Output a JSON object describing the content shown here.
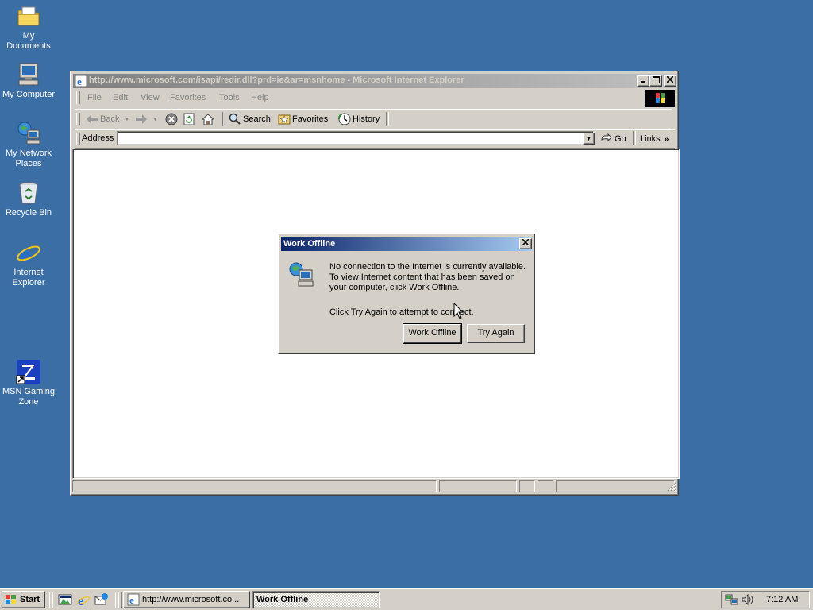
{
  "desktop": {
    "icons": [
      {
        "label": "My Documents",
        "icon": "folder-documents-icon"
      },
      {
        "label": "My Computer",
        "icon": "computer-icon"
      },
      {
        "label": "My Network Places",
        "icon": "network-places-icon"
      },
      {
        "label": "Recycle Bin",
        "icon": "recycle-bin-icon"
      },
      {
        "label": "Internet Explorer",
        "icon": "internet-explorer-icon"
      },
      {
        "label": "MSN Gaming Zone",
        "icon": "msn-gaming-zone-icon"
      }
    ]
  },
  "browser": {
    "title": "http://www.microsoft.com/isapi/redir.dll?prd=ie&ar=msnhome - Microsoft Internet Explorer",
    "menu": [
      "File",
      "Edit",
      "View",
      "Favorites",
      "Tools",
      "Help"
    ],
    "toolbar": {
      "back": "Back",
      "search": "Search",
      "favorites": "Favorites",
      "history": "History"
    },
    "address": {
      "label": "Address",
      "value": "",
      "go": "Go",
      "links": "Links"
    }
  },
  "dialog": {
    "title": "Work Offline",
    "message_lines": [
      "No connection to the Internet is currently available.",
      "To view Internet content that has been saved on",
      "your computer, click Work Offline."
    ],
    "hint": "Click Try Again to attempt to connect.",
    "buttons": {
      "work_offline": "Work Offline",
      "try_again": "Try Again"
    }
  },
  "taskbar": {
    "start": "Start",
    "tasks": [
      {
        "label": "http://www.microsoft.co...",
        "active": false
      },
      {
        "label": "Work Offline",
        "active": true
      }
    ],
    "clock": "7:12 AM"
  },
  "colors": {
    "desktop": "#3a6ea5",
    "face": "#d4d0c8",
    "active_title_start": "#0a246a",
    "active_title_end": "#a6caf0",
    "inactive_title_start": "#808080",
    "inactive_title_end": "#c0c0c0"
  }
}
